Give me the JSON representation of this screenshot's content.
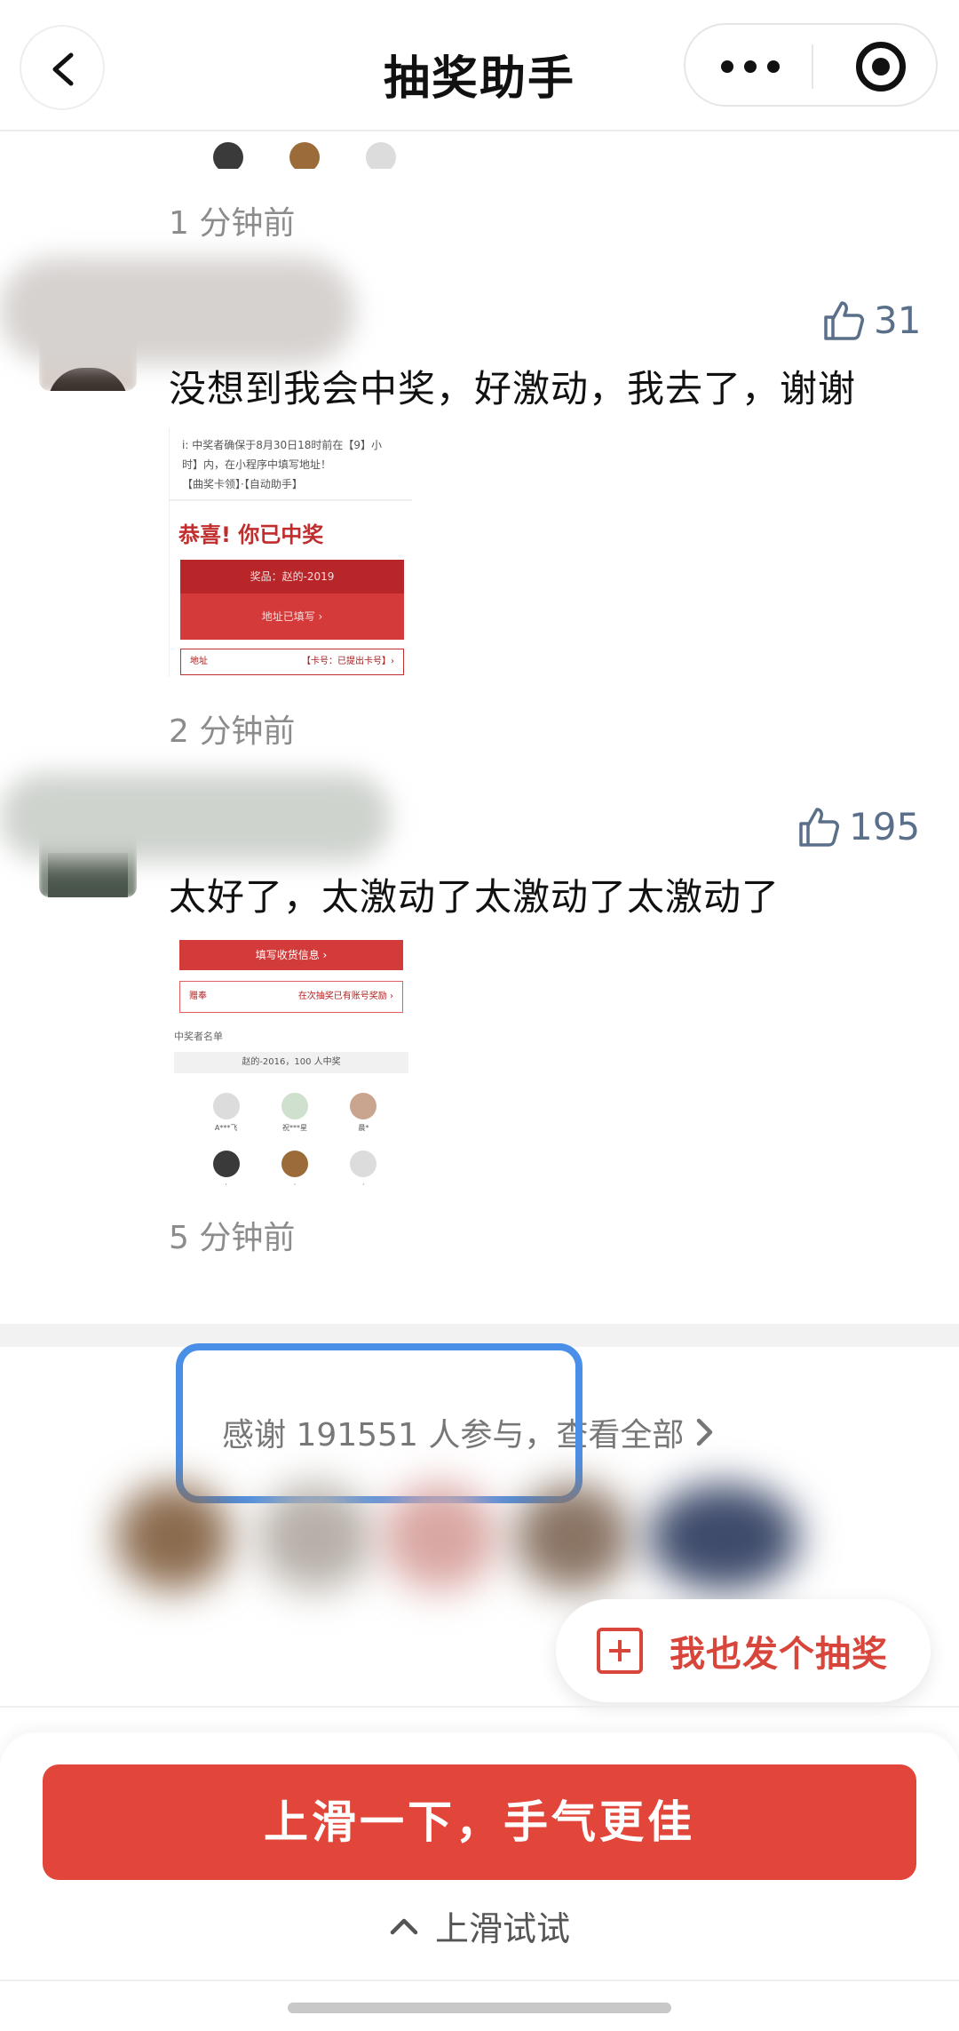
{
  "nav": {
    "title": "抽奖助手"
  },
  "comments": [
    {
      "time": "1 分钟前"
    },
    {
      "likes": "31",
      "text": "没想到我会中奖，好激动，我去了，谢谢",
      "shot": {
        "congrats": "恭喜! 你已中奖"
      },
      "time": "2 分钟前"
    },
    {
      "likes": "195",
      "text": "太好了，太激动了太激动了太激动了",
      "shot": {
        "winners_label": "中奖者名单"
      },
      "time": "5 分钟前"
    }
  ],
  "participants": {
    "text": "感谢 191551 人参与，查看全部"
  },
  "fab": {
    "label": "我也发个抽奖"
  },
  "cta": {
    "label": "上滑一下，手气更佳"
  },
  "hint": {
    "label": "上滑试试"
  },
  "colors": {
    "accent": "#e2463a",
    "highlight": "#4a8fe7",
    "like": "#5a6f8a"
  }
}
